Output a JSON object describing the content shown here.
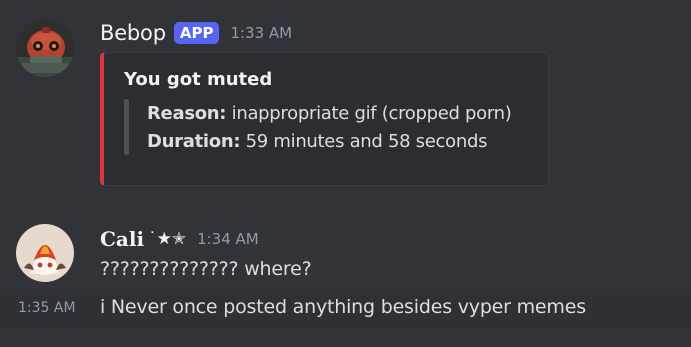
{
  "messages": [
    {
      "author": "Bebop",
      "badge": "APP",
      "timestamp": "1:33 AM",
      "avatar_icon": "robot-avatar",
      "embed": {
        "accent_color": "#da373c",
        "title": "You got muted",
        "fields": [
          {
            "key": "Reason:",
            "value": "inappropriate gif (cropped porn)"
          },
          {
            "key": "Duration:",
            "value": "59 minutes and 58 seconds"
          }
        ]
      }
    },
    {
      "author": "Cali",
      "author_decoration": "˙★✭",
      "timestamp": "1:34 AM",
      "avatar_icon": "anime-character-avatar",
      "text": "?????????????? where?"
    },
    {
      "timestamp": "1:35 AM",
      "text": "i Never once posted anything besides vyper memes"
    }
  ],
  "colors": {
    "background": "#313338",
    "badge": "#5865f2",
    "embed_background": "#2b2d31"
  }
}
